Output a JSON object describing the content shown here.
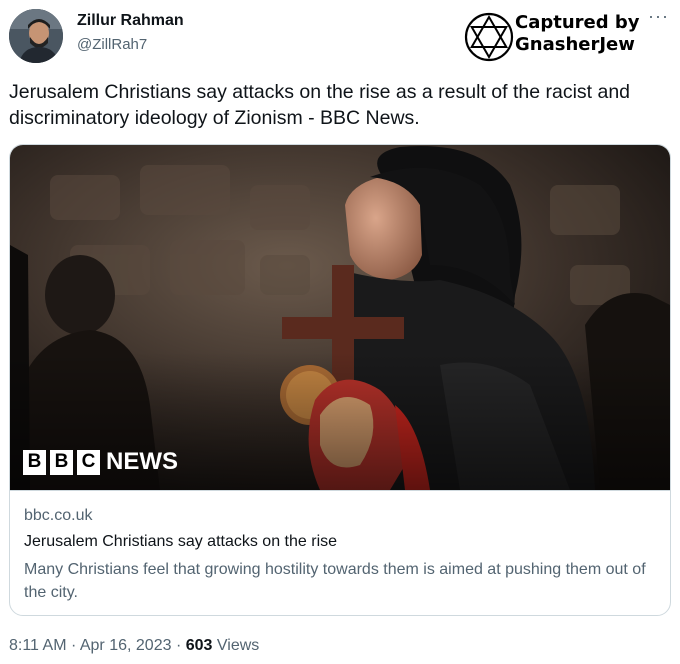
{
  "author": {
    "name": "Zillur Rahman",
    "handle": "@ZillRah7"
  },
  "watermark": {
    "line1": "Captured by",
    "line2": "GnasherJew"
  },
  "tweet": {
    "text": "Jerusalem Christians say attacks on the rise as a result of the racist and discriminatory ideology of Zionism - BBC News."
  },
  "card": {
    "logo": {
      "boxes": [
        "B",
        "B",
        "C"
      ],
      "word": "NEWS"
    },
    "domain": "bbc.co.uk",
    "title": "Jerusalem Christians say attacks on the rise",
    "description": "Many Christians feel that growing hostility towards them is aimed at pushing them out of the city."
  },
  "meta": {
    "time": "8:11 AM",
    "separator": "·",
    "date": "Apr 16, 2023",
    "views_count": "603",
    "views_label": "Views"
  },
  "icons": {
    "more": "more-horizontal-icon",
    "watermark": "star-of-david-icon"
  }
}
